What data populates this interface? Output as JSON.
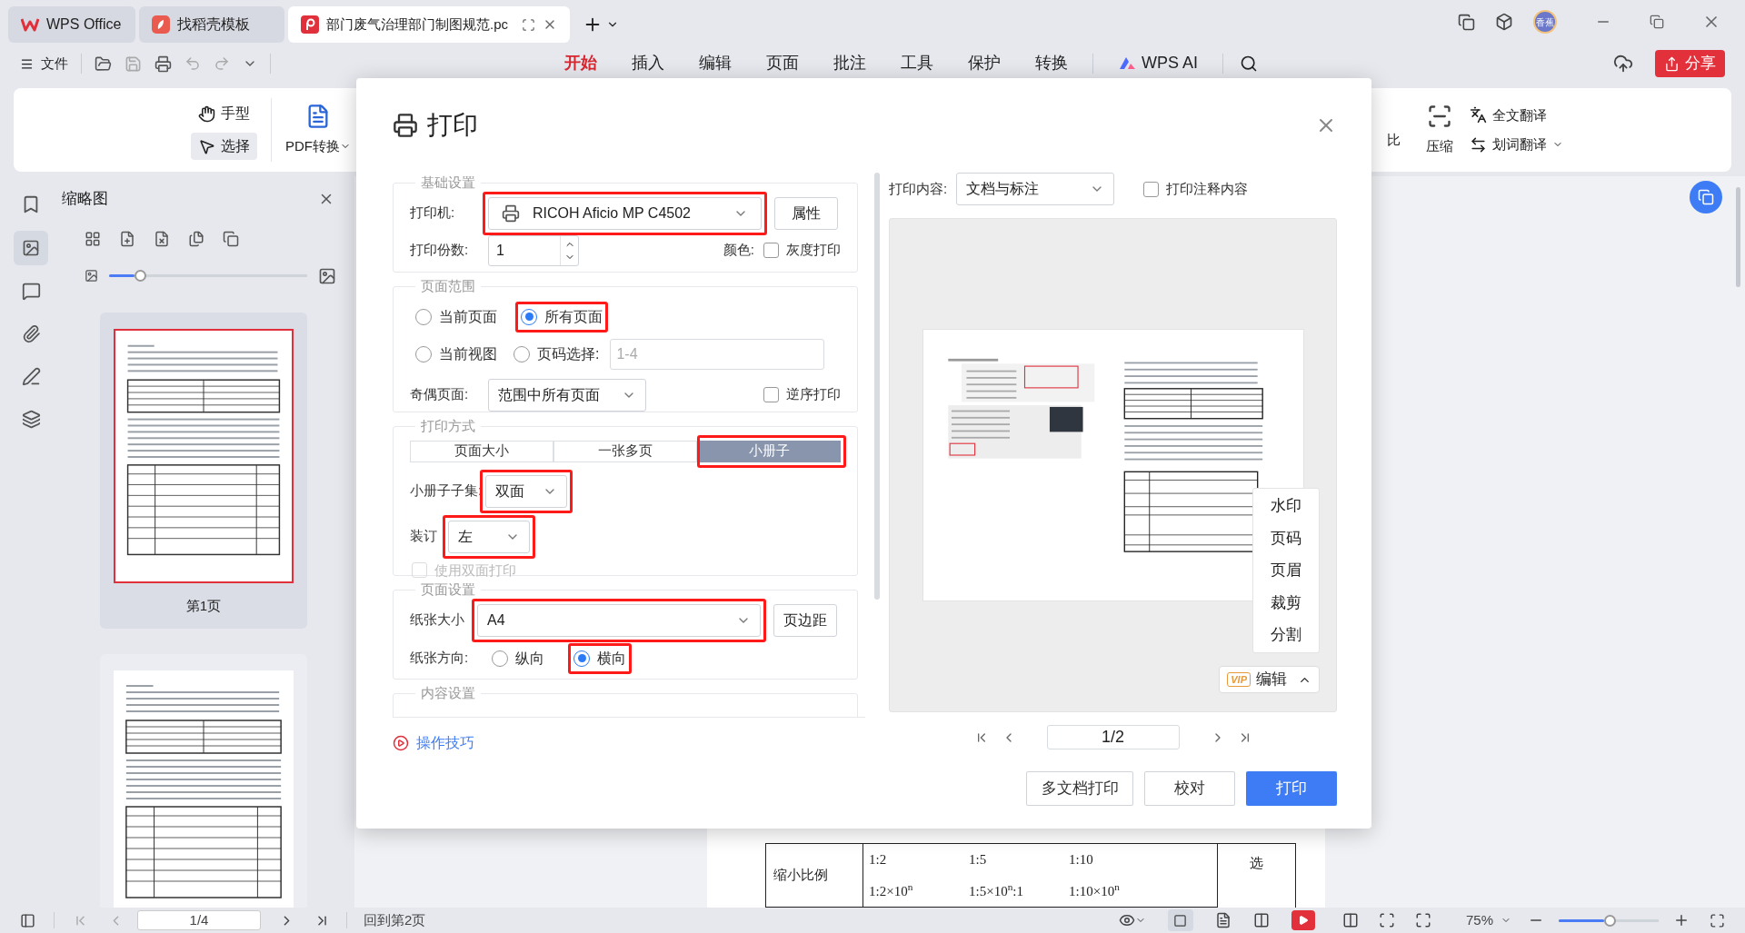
{
  "tabs": [
    {
      "label": "WPS Office",
      "selected": false,
      "kind": "home"
    },
    {
      "label": "找稻壳模板",
      "selected": false,
      "kind": "template"
    },
    {
      "label": "部门废气治理部门制图规范.pc",
      "selected": true,
      "kind": "pdf"
    }
  ],
  "avatar": "香蕉",
  "menu": {
    "file": "文件",
    "share": "分享",
    "ribbon_tabs": [
      {
        "label": "开始",
        "selected": true,
        "kind": "text"
      },
      {
        "label": "插入",
        "selected": false,
        "kind": "text"
      },
      {
        "label": "编辑",
        "selected": false,
        "kind": "text"
      },
      {
        "label": "页面",
        "selected": false,
        "kind": "text"
      },
      {
        "label": "批注",
        "selected": false,
        "kind": "text"
      },
      {
        "label": "工具",
        "selected": false,
        "kind": "text"
      },
      {
        "label": "保护",
        "selected": false,
        "kind": "text"
      },
      {
        "label": "转换",
        "selected": false,
        "kind": "text"
      },
      {
        "label": "WPS AI",
        "selected": false,
        "kind": "ai"
      }
    ]
  },
  "ribbon": {
    "modes": [
      {
        "label": "手型",
        "selected": false,
        "kind": "hand"
      },
      {
        "label": "选择",
        "selected": true,
        "kind": "select"
      }
    ],
    "pdf_convert": "PDF转换",
    "compare": "比",
    "compress": "压缩",
    "translate_full": "全文翻译",
    "translate_word": "划词翻译"
  },
  "thumbnails": {
    "title": "缩略图",
    "size_slider": {
      "level": 0.13
    },
    "pages": [
      {
        "label": "第1页",
        "selected": true
      },
      {
        "selected": false
      }
    ]
  },
  "document": {
    "rows": [
      {
        "label": "缩小比例",
        "lines": [
          [
            "1:2",
            "1:5",
            "1:10"
          ],
          [
            "1:2×10$^{n}$",
            "1:5×10$^{n}$:1",
            "1:10×10$^{n}$"
          ]
        ]
      }
    ],
    "side_note": "选"
  },
  "dialog": {
    "title": "打印",
    "basic": {
      "title": "基础设置",
      "printer_label": "打印机:",
      "printer": {
        "value": "RICOH Aficio MP C4502",
        "annotated": true
      },
      "properties": "属性",
      "copies_label": "打印份数:",
      "copies": "1",
      "color_label": "颜色:",
      "grayscale": {
        "label": "灰度打印",
        "checked": false
      }
    },
    "range": {
      "title": "页面范围",
      "options": [
        {
          "label": "当前页面",
          "selected": false,
          "annotated": false
        },
        {
          "label": "所有页面",
          "selected": true,
          "annotated": true
        },
        {
          "label": "当前视图",
          "selected": false,
          "annotated": false
        },
        {
          "label": "页码选择:",
          "selected": false,
          "annotated": false
        }
      ],
      "pages_placeholder": "1-4",
      "odd_even_label": "奇偶页面:",
      "odd_even": "范围中所有页面",
      "reverse": {
        "label": "逆序打印",
        "checked": false
      }
    },
    "mode": {
      "title": "打印方式",
      "tabs": [
        {
          "label": "页面大小",
          "selected": false,
          "annotated": false
        },
        {
          "label": "一张多页",
          "selected": false,
          "annotated": false
        },
        {
          "label": "小册子",
          "selected": true,
          "annotated": true
        }
      ],
      "subset_label": "小册子子集:",
      "subset": {
        "value": "双面",
        "annotated": true
      },
      "binding_label": "装订",
      "binding": {
        "value": "左",
        "annotated": true
      },
      "duplex": {
        "label": "使用双面打印",
        "checked": false,
        "disabled": true
      }
    },
    "page": {
      "title": "页面设置",
      "paper_label": "纸张大小",
      "paper": {
        "value": "A4",
        "annotated": true
      },
      "margins": "页边距",
      "orientation_label": "纸张方向:",
      "orientations": [
        {
          "label": "纵向",
          "selected": false,
          "annotated": false
        },
        {
          "label": "横向",
          "selected": true,
          "annotated": true
        }
      ]
    },
    "content": {
      "title": "内容设置"
    },
    "tips": "操作技巧",
    "print_content_label": "打印内容:",
    "print_content": "文档与标注",
    "print_comments": {
      "label": "打印注释内容",
      "checked": false
    },
    "edit_menu": [
      "水印",
      "页码",
      "页眉",
      "裁剪",
      "分割"
    ],
    "edit_button": {
      "badge": "VIP",
      "label": "编辑"
    },
    "pager": "1/2",
    "buttons": [
      {
        "label": "多文档打印",
        "kind": "secondary"
      },
      {
        "label": "校对",
        "kind": "secondary"
      },
      {
        "label": "打印",
        "kind": "primary"
      }
    ]
  },
  "status": {
    "page": "1/4",
    "back": "回到第2页",
    "zoom": "75%",
    "zoom_slider": {
      "level": 0.45
    }
  }
}
